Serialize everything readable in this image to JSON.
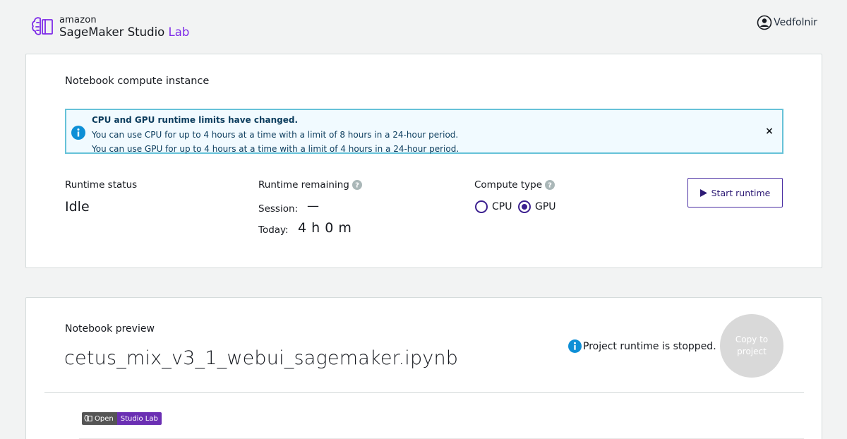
{
  "header": {
    "logo_amazon": "amazon",
    "logo_product": "SageMaker Studio",
    "logo_lab": "Lab",
    "user_name": "Vedfolnir"
  },
  "compute": {
    "title": "Notebook compute instance",
    "alert": {
      "heading": "CPU and GPU runtime limits have changed.",
      "line1": "You can use CPU for up to 4 hours at a time with a limit of 8 hours in a 24-hour period.",
      "line2": "You can use GPU for up to 4 hours at a time with a limit of 4 hours in a 24-hour period.",
      "close": "×"
    },
    "runtime_status_label": "Runtime status",
    "runtime_status_value": "Idle",
    "runtime_remaining_label": "Runtime remaining",
    "session_label": "Session:",
    "session_value": "—",
    "today_label": "Today:",
    "today_value": "4 h 0 m",
    "compute_type_label": "Compute type",
    "options": [
      {
        "label": "CPU",
        "selected": false
      },
      {
        "label": "GPU",
        "selected": true
      }
    ],
    "start_button": "Start runtime"
  },
  "preview": {
    "title": "Notebook preview",
    "notebook_name": "cetus_mix_v3_1_webui_sagemaker.ipynb",
    "status_text": "Project runtime is stopped.",
    "copy_button": "Copy to project",
    "badge_left": "Open",
    "badge_right": "Studio Lab"
  },
  "colors": {
    "accent": "#7d2ae8",
    "info_blue": "#0073bb",
    "alert_border": "#66c2d8",
    "radio": "#3b1f8f"
  }
}
